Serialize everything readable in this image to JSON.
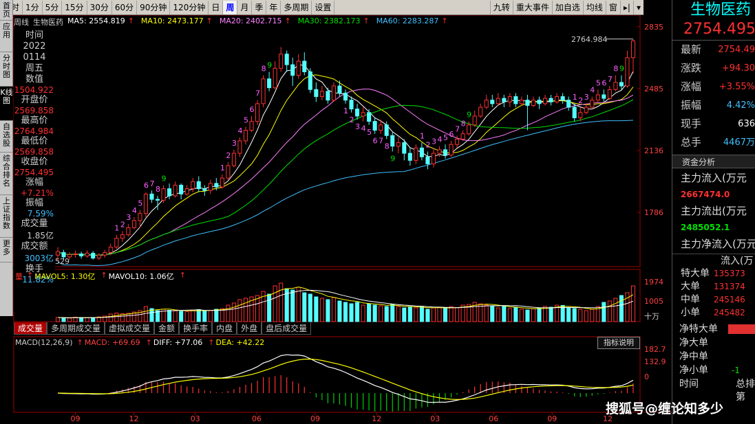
{
  "period_tabs": [
    "分时",
    "1分",
    "5分",
    "15分",
    "30分",
    "60分",
    "90分钟",
    "120分钟",
    "日",
    "周",
    "月",
    "季",
    "年",
    "多周期",
    "设置"
  ],
  "active_period": "周",
  "right_buttons": [
    "九转",
    "重大事件",
    "加自选",
    "均线",
    "窗"
  ],
  "left_nav": [
    "首页",
    "应用",
    "分时图",
    "K线图",
    "自选股",
    "综合排名",
    "上证指数",
    "更多"
  ],
  "active_left_nav": "K线图",
  "info_panel": {
    "time_label": "时间",
    "year": "2022",
    "date": "0114",
    "weekday": "周五",
    "value_label": "数值",
    "value": "1504.922",
    "open_label": "开盘价",
    "open": "2569.858",
    "high_label": "最高价",
    "high": "2764.984",
    "low_label": "最低价",
    "low": "2569.858",
    "close_label": "收盘价",
    "close": "2754.495",
    "change_label": "涨幅",
    "change": "+7.21%",
    "amp_label": "振幅",
    "amp": "7.59%",
    "vol_label": "成交量",
    "vol": "1.85亿",
    "amount_label": "成交额",
    "amount": "3003亿",
    "turnover_label": "换手",
    "turnover": "11.82%"
  },
  "ma_legend": {
    "prefix": "周线",
    "name": "生物医药",
    "items": [
      {
        "label": "MA5: 2554.819",
        "color": "#ffffff"
      },
      {
        "label": "MA10: 2473.177",
        "color": "#ffff00"
      },
      {
        "label": "MA20: 2402.715",
        "color": "#ff80ff"
      },
      {
        "label": "MA30: 2382.173",
        "color": "#00e000"
      },
      {
        "label": "MA60: 2283.287",
        "color": "#40c0ff"
      }
    ]
  },
  "price_axis": [
    "2835",
    "2485",
    "2136",
    "1786"
  ],
  "high_marker": "2764.984",
  "low_marker": "529",
  "vol_legend": {
    "prefix": "量",
    "items": [
      {
        "label": "MAVOL5: 1.30亿",
        "color": "#ffff00"
      },
      {
        "label": "MAVOL10: 1.06亿",
        "color": "#ffffff"
      }
    ]
  },
  "vol_axis": [
    "1974",
    "1005",
    "十万"
  ],
  "sub_tabs": [
    "成交量",
    "多周期成交量",
    "虚拟成交量",
    "金额",
    "换手率",
    "内盘",
    "外盘",
    "盘后成交量"
  ],
  "active_sub_tab": "成交量",
  "macd_legend": {
    "name": "MACD(12,26,9)",
    "items": [
      {
        "label": "MACD: +69.69",
        "color": "#ff4040"
      },
      {
        "label": "DIFF: +77.06",
        "color": "#ffffff"
      },
      {
        "label": "DEA: +42.22",
        "color": "#ffff00"
      }
    ]
  },
  "macd_axis": [
    "182.7",
    "132.9",
    "0"
  ],
  "indicator_button": "指标说明",
  "time_axis": [
    "09",
    "12",
    "03",
    "06",
    "09",
    "12",
    "03",
    "06",
    "09",
    "12"
  ],
  "nine_turn_labels": [
    "1",
    "2",
    "3",
    "4",
    "5",
    "6",
    "7",
    "8",
    "9"
  ],
  "right_panel": {
    "stock_name": "生物医药",
    "price": "2754.495",
    "quotes": [
      {
        "label": "最新",
        "value": "2754.49",
        "color": "#ff3030"
      },
      {
        "label": "涨跌",
        "value": "+94.30",
        "color": "#ff3030"
      },
      {
        "label": "涨幅",
        "value": "+3.55%",
        "color": "#ff3030"
      },
      {
        "label": "振幅",
        "value": "4.42%",
        "color": "#40c0ff"
      },
      {
        "label": "现手",
        "value": "636",
        "color": "#ffffff"
      },
      {
        "label": "总手",
        "value": "4467万",
        "color": "#40c0ff"
      }
    ],
    "fund_header": "资金分析",
    "inflow_label": "主力流入(万元",
    "inflow_value": "2667474.0",
    "outflow_label": "主力流出(万元",
    "outflow_value": "2485052.1",
    "net_label": "主力净流入(万元",
    "flow_header": "流入(万",
    "orders": [
      {
        "label": "特大单",
        "value": "135373"
      },
      {
        "label": "大单",
        "value": "131374"
      },
      {
        "label": "中单",
        "value": "245146"
      },
      {
        "label": "小单",
        "value": "245482"
      }
    ],
    "net_rows": [
      {
        "label": "净特大单",
        "value": ""
      },
      {
        "label": "净大单",
        "value": ""
      },
      {
        "label": "净中单",
        "value": ""
      },
      {
        "label": "净小单",
        "value": "-1"
      }
    ],
    "footer_a": "时间",
    "footer_b": "总排",
    "footer_c": "第"
  },
  "watermark": "搜狐号@缠论知多少",
  "chart_data": {
    "type": "candlestick",
    "series_ma": [
      "MA5",
      "MA10",
      "MA20",
      "MA30",
      "MA60"
    ],
    "last_close": 2754.495,
    "last_high": 2764.984,
    "y_ticks": [
      2835,
      2485,
      2136,
      1786
    ],
    "candles": [
      [
        1545,
        1565,
        1510,
        1590
      ],
      [
        1560,
        1535,
        1520,
        1575
      ],
      [
        1535,
        1548,
        1520,
        1560
      ],
      [
        1548,
        1552,
        1530,
        1570
      ],
      [
        1552,
        1540,
        1525,
        1565
      ],
      [
        1540,
        1556,
        1530,
        1572
      ],
      [
        1556,
        1528,
        1520,
        1568
      ],
      [
        1528,
        1545,
        1518,
        1555
      ],
      [
        1545,
        1560,
        1530,
        1575
      ],
      [
        1560,
        1590,
        1545,
        1610
      ],
      [
        1590,
        1640,
        1580,
        1660
      ],
      [
        1640,
        1660,
        1620,
        1680
      ],
      [
        1660,
        1700,
        1650,
        1720
      ],
      [
        1700,
        1740,
        1690,
        1760
      ],
      [
        1740,
        1780,
        1700,
        1800
      ],
      [
        1780,
        1890,
        1760,
        1900
      ],
      [
        1890,
        1860,
        1840,
        1910
      ],
      [
        1860,
        1855,
        1800,
        1880
      ],
      [
        1855,
        1920,
        1840,
        1940
      ],
      [
        1920,
        1880,
        1860,
        1950
      ],
      [
        1880,
        1940,
        1870,
        1960
      ],
      [
        1940,
        1890,
        1860,
        1950
      ],
      [
        1890,
        1920,
        1880,
        1940
      ],
      [
        1920,
        1960,
        1900,
        1980
      ],
      [
        1960,
        1920,
        1900,
        1990
      ],
      [
        1920,
        1910,
        1880,
        1940
      ],
      [
        1910,
        1950,
        1890,
        1970
      ],
      [
        1950,
        1930,
        1910,
        1980
      ],
      [
        1930,
        1980,
        1920,
        2000
      ],
      [
        1980,
        2050,
        1970,
        2070
      ],
      [
        2050,
        2120,
        2040,
        2140
      ],
      [
        2120,
        2190,
        2100,
        2210
      ],
      [
        2190,
        2250,
        2170,
        2270
      ],
      [
        2250,
        2300,
        2240,
        2330
      ],
      [
        2300,
        2400,
        2280,
        2420
      ],
      [
        2400,
        2540,
        2380,
        2560
      ],
      [
        2540,
        2490,
        2470,
        2580
      ],
      [
        2490,
        2600,
        2480,
        2640
      ],
      [
        2600,
        2680,
        2580,
        2720
      ],
      [
        2680,
        2620,
        2580,
        2700
      ],
      [
        2620,
        2560,
        2500,
        2660
      ],
      [
        2560,
        2640,
        2540,
        2680
      ],
      [
        2640,
        2580,
        2560,
        2690
      ],
      [
        2580,
        2480,
        2460,
        2600
      ],
      [
        2480,
        2440,
        2410,
        2520
      ],
      [
        2440,
        2470,
        2420,
        2500
      ],
      [
        2470,
        2420,
        2400,
        2490
      ],
      [
        2420,
        2500,
        2410,
        2520
      ],
      [
        2500,
        2460,
        2440,
        2530
      ],
      [
        2460,
        2420,
        2400,
        2480
      ],
      [
        2420,
        2370,
        2350,
        2440
      ],
      [
        2370,
        2330,
        2310,
        2400
      ],
      [
        2330,
        2350,
        2300,
        2380
      ],
      [
        2350,
        2300,
        2280,
        2370
      ],
      [
        2300,
        2250,
        2230,
        2320
      ],
      [
        2250,
        2280,
        2230,
        2310
      ],
      [
        2280,
        2220,
        2200,
        2300
      ],
      [
        2220,
        2160,
        2130,
        2240
      ],
      [
        2160,
        2180,
        2120,
        2210
      ],
      [
        2180,
        2120,
        2080,
        2200
      ],
      [
        2120,
        2080,
        2050,
        2150
      ],
      [
        2080,
        2150,
        2060,
        2170
      ],
      [
        2150,
        2100,
        2080,
        2180
      ],
      [
        2100,
        2060,
        2030,
        2130
      ],
      [
        2060,
        2120,
        2040,
        2150
      ],
      [
        2120,
        2140,
        2100,
        2160
      ],
      [
        2140,
        2110,
        2090,
        2170
      ],
      [
        2110,
        2170,
        2100,
        2190
      ],
      [
        2170,
        2200,
        2150,
        2220
      ],
      [
        2200,
        2230,
        2190,
        2250
      ],
      [
        2230,
        2280,
        2220,
        2300
      ],
      [
        2280,
        2330,
        2270,
        2360
      ],
      [
        2330,
        2380,
        2320,
        2400
      ],
      [
        2380,
        2420,
        2370,
        2450
      ],
      [
        2420,
        2400,
        2380,
        2450
      ],
      [
        2400,
        2430,
        2390,
        2460
      ],
      [
        2430,
        2410,
        2380,
        2450
      ],
      [
        2410,
        2440,
        2380,
        2460
      ],
      [
        2440,
        2400,
        2380,
        2460
      ],
      [
        2400,
        2420,
        2390,
        2440
      ],
      [
        2420,
        2390,
        2250,
        2450
      ],
      [
        2390,
        2420,
        2380,
        2440
      ],
      [
        2420,
        2400,
        2370,
        2440
      ],
      [
        2400,
        2430,
        2390,
        2450
      ],
      [
        2430,
        2410,
        2390,
        2450
      ],
      [
        2410,
        2440,
        2400,
        2460
      ],
      [
        2440,
        2420,
        2400,
        2460
      ],
      [
        2420,
        2380,
        2360,
        2440
      ],
      [
        2380,
        2320,
        2300,
        2400
      ],
      [
        2320,
        2350,
        2300,
        2380
      ],
      [
        2350,
        2380,
        2340,
        2400
      ],
      [
        2380,
        2420,
        2370,
        2440
      ],
      [
        2420,
        2450,
        2400,
        2480
      ],
      [
        2450,
        2430,
        2410,
        2480
      ],
      [
        2430,
        2480,
        2420,
        2500
      ],
      [
        2480,
        2520,
        2470,
        2560
      ],
      [
        2520,
        2500,
        2480,
        2560
      ],
      [
        2500,
        2660,
        2490,
        2700
      ],
      [
        2660,
        2754.5,
        2569.9,
        2764.9
      ]
    ],
    "volumes": [
      30,
      28,
      26,
      32,
      30,
      28,
      30,
      34,
      40,
      55,
      62,
      58,
      60,
      70,
      80,
      110,
      95,
      80,
      90,
      82,
      78,
      75,
      72,
      85,
      88,
      80,
      82,
      90,
      95,
      120,
      135,
      160,
      170,
      180,
      190,
      220,
      200,
      260,
      280,
      240,
      230,
      250,
      210,
      200,
      180,
      170,
      160,
      175,
      150,
      140,
      130,
      140,
      120,
      130,
      120,
      115,
      110,
      125,
      110,
      100,
      105,
      100,
      110,
      90,
      100,
      105,
      95,
      110,
      100,
      120,
      125,
      140,
      130,
      120,
      110,
      100,
      115,
      95,
      105,
      90,
      85,
      95,
      100,
      110,
      105,
      120,
      118,
      100,
      95,
      90,
      80,
      90,
      110,
      140,
      150,
      170,
      190,
      210,
      260
    ]
  }
}
